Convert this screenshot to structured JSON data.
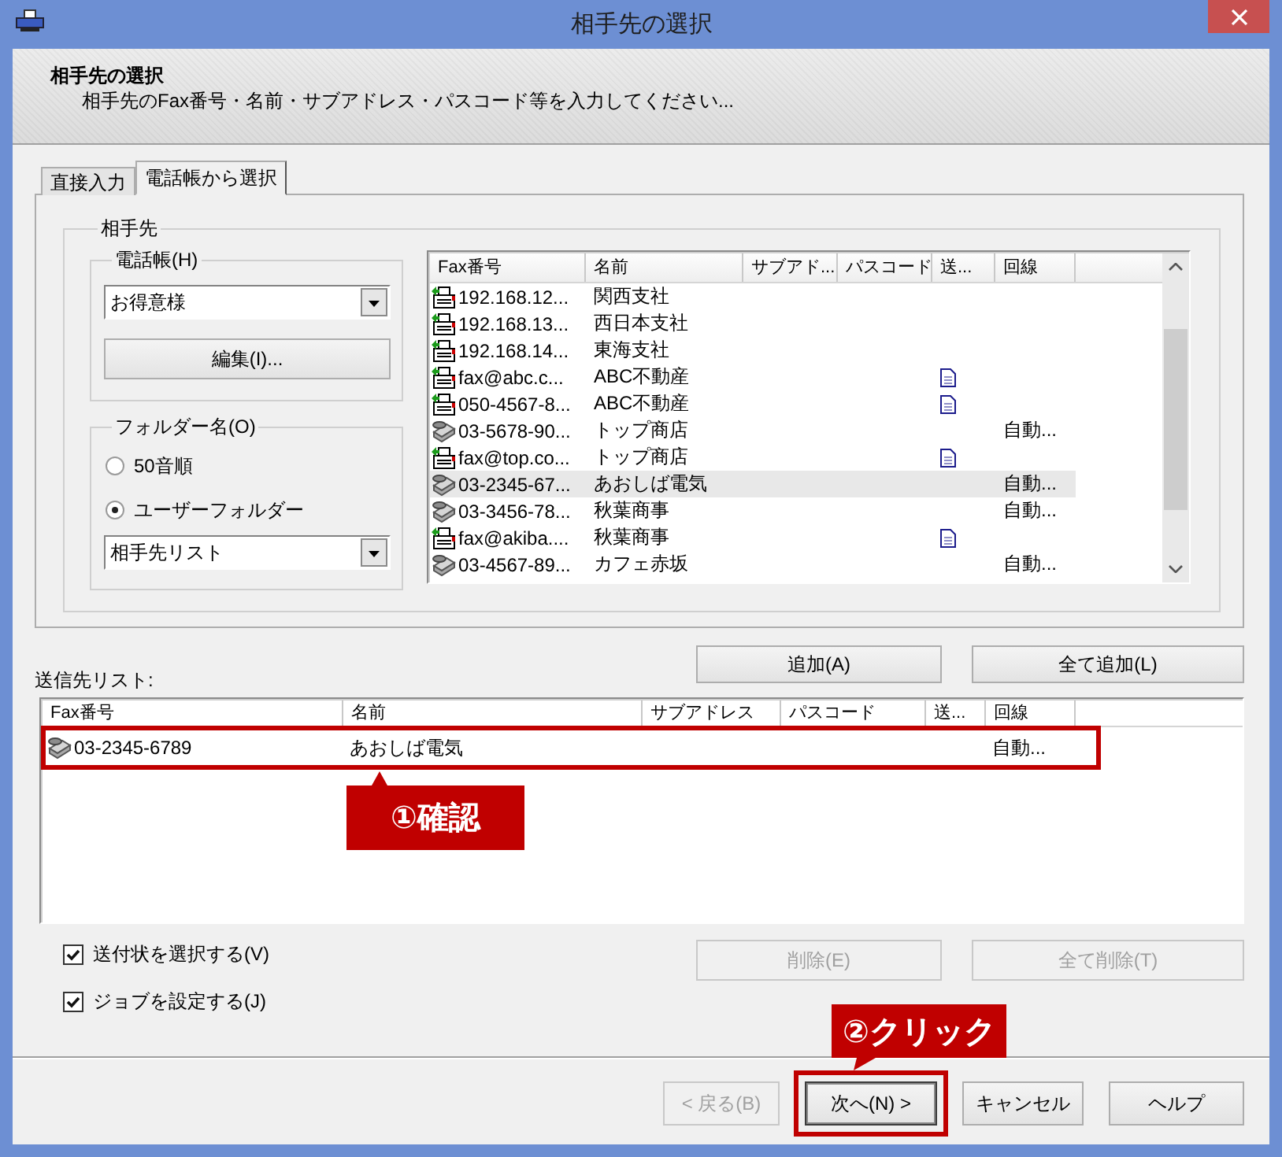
{
  "window": {
    "title": "相手先の選択"
  },
  "header": {
    "title": "相手先の選択",
    "subtitle": "相手先のFax番号・名前・サブアドレス・パスコード等を入力してください..."
  },
  "tabs": [
    {
      "label": "直接入力",
      "selected": false
    },
    {
      "label": "電話帳から選択",
      "selected": true
    }
  ],
  "contacts": {
    "title": "相手先",
    "phonebook": {
      "title": "電話帳(H)",
      "value": "お得意様",
      "edit_button": "編集(I)..."
    },
    "folder": {
      "title": "フォルダー名(O)",
      "options": [
        {
          "label": "50音順",
          "selected": false
        },
        {
          "label": "ユーザーフォルダー",
          "selected": true
        }
      ],
      "value": "相手先リスト"
    },
    "list": {
      "columns": [
        "Fax番号",
        "名前",
        "サブアド...",
        "パスコード",
        "送...",
        "回線"
      ],
      "rows": [
        {
          "kind": "network",
          "fax": "192.168.12...",
          "name": "関西支社",
          "cover": false,
          "selected": false
        },
        {
          "kind": "network",
          "fax": "192.168.13...",
          "name": "西日本支社",
          "cover": false,
          "selected": false
        },
        {
          "kind": "network",
          "fax": "192.168.14...",
          "name": "東海支社",
          "cover": false,
          "selected": false
        },
        {
          "kind": "network",
          "fax": "fax@abc.c...",
          "name": "ABC不動産",
          "cover": true,
          "selected": false
        },
        {
          "kind": "network",
          "fax": "050-4567-8...",
          "name": "ABC不動産",
          "cover": true,
          "selected": false
        },
        {
          "kind": "phone",
          "fax": "03-5678-90...",
          "name": "トップ商店",
          "cover": false,
          "line": "自動...",
          "selected": false
        },
        {
          "kind": "network",
          "fax": "fax@top.co...",
          "name": "トップ商店",
          "cover": true,
          "selected": false
        },
        {
          "kind": "phone",
          "fax": "03-2345-67...",
          "name": "あおしば電気",
          "cover": false,
          "line": "自動...",
          "selected": true
        },
        {
          "kind": "phone",
          "fax": "03-3456-78...",
          "name": "秋葉商事",
          "cover": false,
          "line": "自動...",
          "selected": false
        },
        {
          "kind": "network",
          "fax": "fax@akiba....",
          "name": "秋葉商事",
          "cover": true,
          "selected": false
        },
        {
          "kind": "phone",
          "fax": "03-4567-89...",
          "name": "カフェ赤坂",
          "cover": false,
          "line": "自動...",
          "selected": false
        }
      ]
    }
  },
  "add_buttons": [
    {
      "label": "追加(A)",
      "disabled": false
    },
    {
      "label": "全て追加(L)",
      "disabled": false
    }
  ],
  "recipients": {
    "label": "送信先リスト:",
    "columns": [
      "Fax番号",
      "名前",
      "サブアドレス",
      "パスコード",
      "送...",
      "回線"
    ],
    "rows": [
      {
        "kind": "phone",
        "fax": "03-2345-6789",
        "name": "あおしば電気",
        "cover": false,
        "line": "自動...",
        "selected": false,
        "callout": "①確認"
      }
    ]
  },
  "options": [
    {
      "label": "送付状を選択する(V)",
      "checked": true
    },
    {
      "label": "ジョブを設定する(J)",
      "checked": true
    }
  ],
  "remove_buttons": [
    {
      "label": "削除(E)",
      "disabled": true
    },
    {
      "label": "全て削除(T)",
      "disabled": true
    }
  ],
  "nav_buttons": [
    {
      "label": "< 戻る(B)",
      "disabled": true,
      "default": false
    },
    {
      "label": "次へ(N) >",
      "disabled": false,
      "default": true,
      "callout": "②クリック"
    },
    {
      "label": "キャンセル",
      "disabled": false,
      "default": false
    },
    {
      "label": "ヘルプ",
      "disabled": false,
      "default": false
    }
  ]
}
